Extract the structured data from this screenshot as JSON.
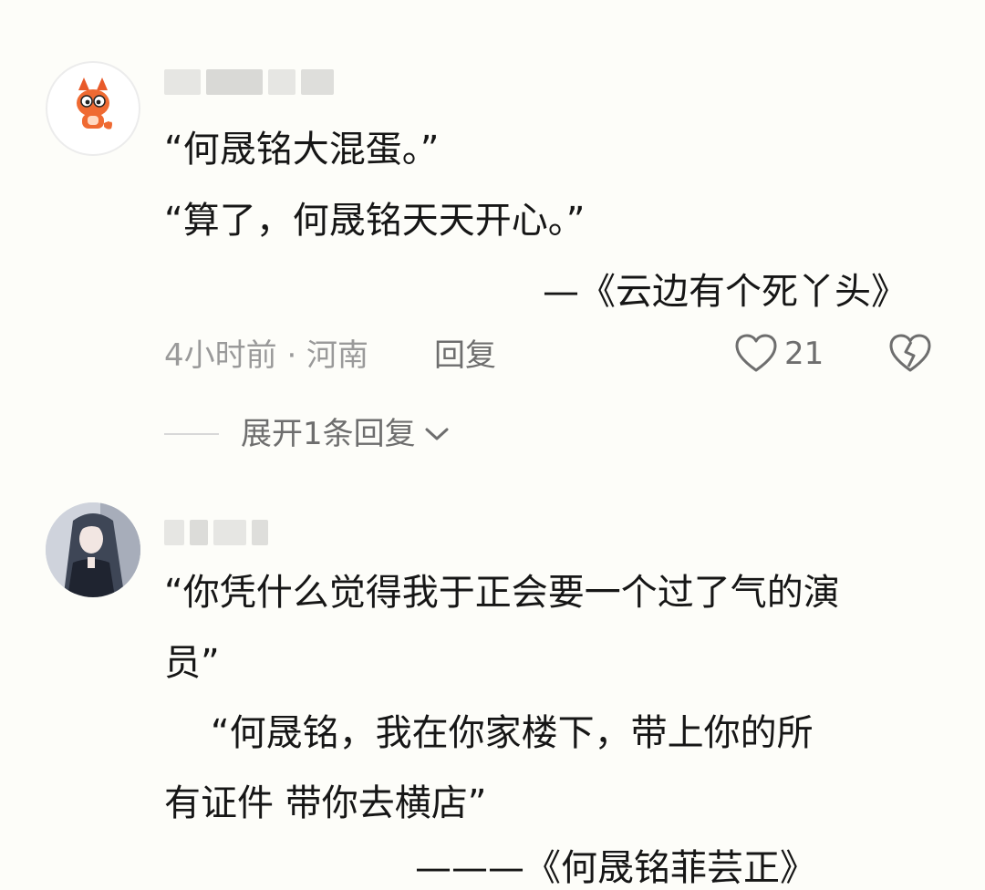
{
  "comments": [
    {
      "lines": [
        "“何晟铭大混蛋。”",
        "“算了，何晟铭天天开心。”"
      ],
      "source": "—《云边有个死丫头》",
      "meta": "4小时前 · 河南",
      "reply_label": "回复",
      "likes": "21",
      "expand_label": "展开1条回复"
    },
    {
      "lines": [
        "“你凭什么觉得我于正会要一个过了气的演",
        "员”",
        "    “何晟铭，我在你家楼下，带上你的所",
        "有证件 带你去横店”"
      ],
      "source": "———《何晟铭菲芸正》"
    }
  ],
  "icons": {
    "like": "heart-outline-icon",
    "dislike": "broken-heart-icon",
    "expand": "chevron-down-icon"
  },
  "colors": {
    "text": "#161616",
    "meta": "#9a9a9a",
    "action": "#6e6e6e",
    "background": "#fdfdf9"
  }
}
